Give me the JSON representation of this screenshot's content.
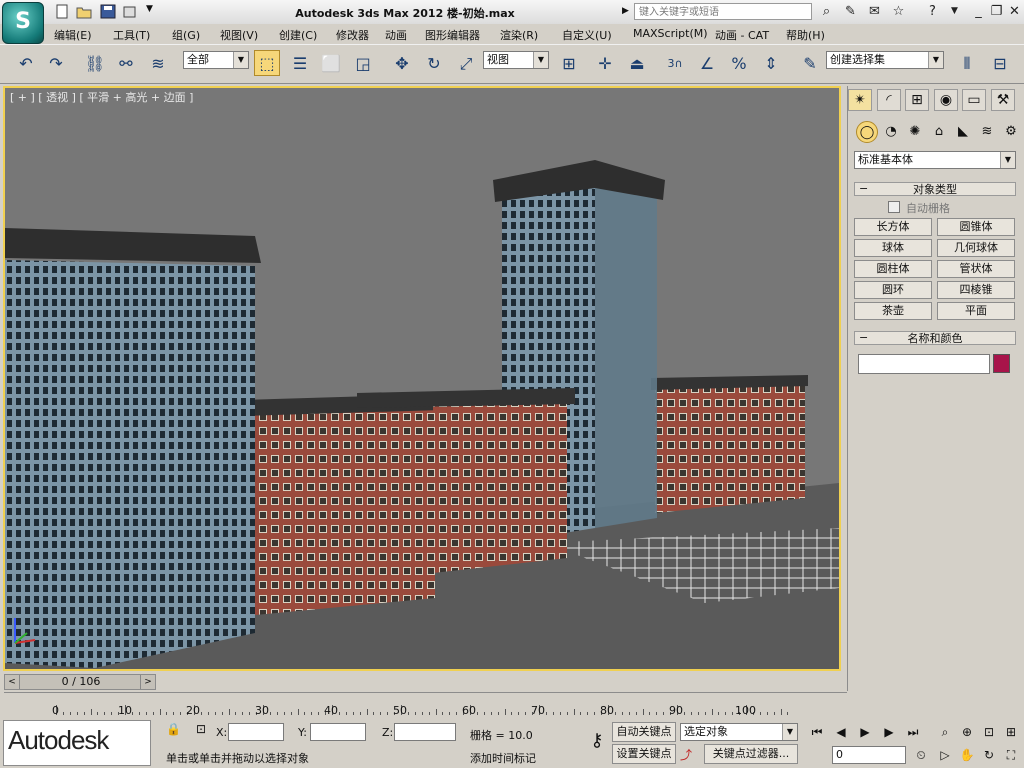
{
  "app": {
    "logo_letter": "S",
    "title": "Autodesk 3ds Max  2012      楼-初始.max",
    "search_placeholder": "键入关键字或短语",
    "window_controls": [
      "_",
      "❐",
      "✕"
    ]
  },
  "menu": [
    "编辑(E)",
    "工具(T)",
    "组(G)",
    "视图(V)",
    "创建(C)",
    "修改器",
    "动画",
    "图形编辑器",
    "渲染(R)",
    "自定义(U)",
    "MAXScript(M)",
    "动画 - CAT",
    "帮助(H)"
  ],
  "toolbar": {
    "selection_filter": "全部",
    "ref_coord": "视图",
    "snap_value": "3",
    "named_selection_placeholder": "创建选择集",
    "icons": [
      "undo-icon",
      "redo-icon",
      "link-icon",
      "unlink-icon",
      "bind-spacewarp-icon",
      "select-object-icon",
      "select-by-name-icon",
      "rect-region-icon",
      "window-crossing-icon",
      "move-icon",
      "rotate-icon",
      "scale-icon",
      "pivot-icon",
      "manipulate-icon",
      "keyboard-shortcut-icon",
      "snap-icon",
      "angle-snap-icon",
      "percent-snap-icon",
      "spinner-snap-icon",
      "edit-named-sel-icon",
      "mirror-icon",
      "align-icon"
    ]
  },
  "viewport": {
    "label": "[ + ] [ 透视 ] [ 平滑 + 高光 + 边面 ]",
    "colors": {
      "background": "#777777",
      "border": "#f0d050",
      "ground": "#5a5a5a"
    }
  },
  "command_panel": {
    "tabs": [
      "create-tab",
      "modify-tab",
      "hierarchy-tab",
      "motion-tab",
      "display-tab",
      "utilities-tab"
    ],
    "subtabs": [
      "geometry-icon",
      "shapes-icon",
      "lights-icon",
      "cameras-icon",
      "helpers-icon",
      "spacewarps-icon",
      "systems-icon"
    ],
    "category": "标准基本体",
    "object_type": {
      "header": "对象类型",
      "autogrid_label": "自动栅格",
      "autogrid_checked": false,
      "buttons": [
        "长方体",
        "圆锥体",
        "球体",
        "几何球体",
        "圆柱体",
        "管状体",
        "圆环",
        "四棱锥",
        "茶壶",
        "平面"
      ]
    },
    "name_color": {
      "header": "名称和颜色",
      "name_value": "",
      "swatch_color": "#a8144a"
    }
  },
  "timeline": {
    "frame_display": "0 / 106",
    "prev": "<",
    "next": ">",
    "ticks": [
      "0",
      "10",
      "20",
      "30",
      "40",
      "50",
      "60",
      "70",
      "80",
      "90",
      "100"
    ]
  },
  "status": {
    "logo_text": "Autodesk",
    "x_label": "X:",
    "y_label": "Y:",
    "z_label": "Z:",
    "grid_label": "栅格 = 10.0",
    "prompt": "单击或单击并拖动以选择对象",
    "add_time_tag": "添加时间标记",
    "auto_key": "自动关键点",
    "set_key": "设置关键点",
    "selected_objects": "选定对象",
    "key_filters": "关键点过滤器...",
    "current_frame": "0"
  }
}
